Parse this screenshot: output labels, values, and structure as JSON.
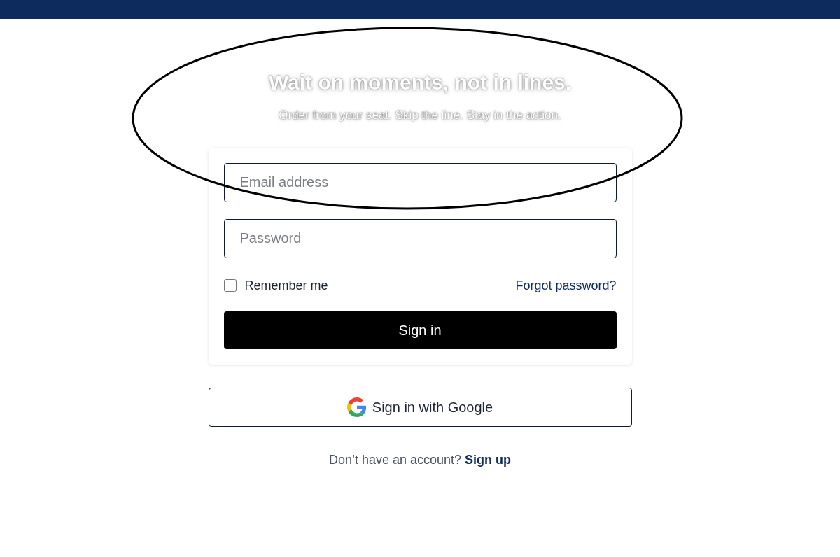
{
  "hero": {
    "title": "Wait on moments, not in lines.",
    "subtitle": "Order from your seat. Skip the line. Stay in the action."
  },
  "form": {
    "email": {
      "placeholder": "Email address"
    },
    "password": {
      "placeholder": "Password"
    },
    "remember": {
      "label": "Remember me",
      "checked": false
    },
    "forgot": "Forgot password?",
    "submit": "Sign in"
  },
  "google_button": "Sign in with Google",
  "signup": {
    "prompt": "Don’t have an account?",
    "link": "Sign up"
  }
}
